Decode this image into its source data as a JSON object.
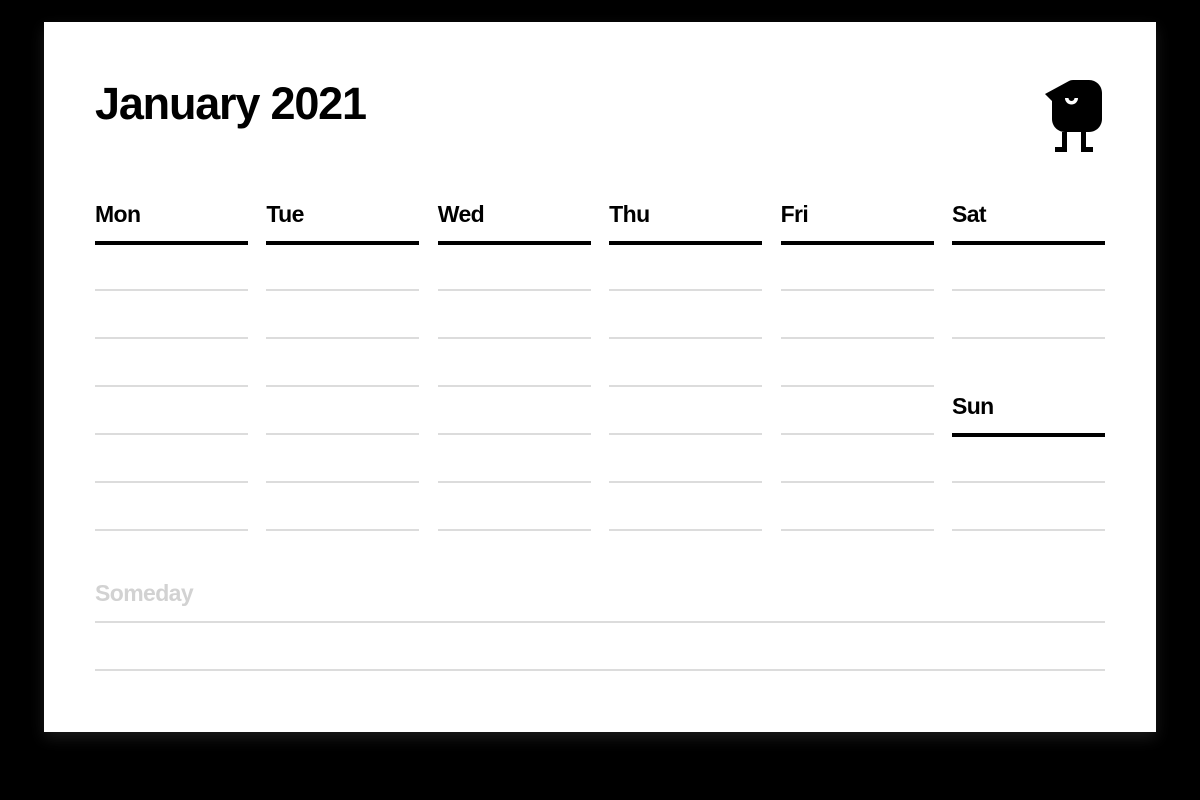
{
  "page": {
    "background_color": "#000000",
    "sheet_color": "#ffffff",
    "title": "January 2021",
    "logo_name": "bird-mascot-logo"
  },
  "planner": {
    "columns": [
      {
        "primary_label": "Mon",
        "secondary_label": "",
        "line_count": 6
      },
      {
        "primary_label": "Tue",
        "secondary_label": "",
        "line_count": 6
      },
      {
        "primary_label": "Wed",
        "secondary_label": "",
        "line_count": 6
      },
      {
        "primary_label": "Thu",
        "secondary_label": "",
        "line_count": 6
      },
      {
        "primary_label": "Fri",
        "secondary_label": "",
        "line_count": 6
      },
      {
        "primary_label": "Sat",
        "secondary_label": "Sun",
        "line_count": 4
      }
    ]
  },
  "someday": {
    "label": "Someday",
    "line_count": 2,
    "label_color": "#d2d2d2"
  },
  "colors": {
    "ink": "#000000",
    "rule_light": "#dcdcdc",
    "paper": "#ffffff",
    "backdrop": "#000000"
  }
}
